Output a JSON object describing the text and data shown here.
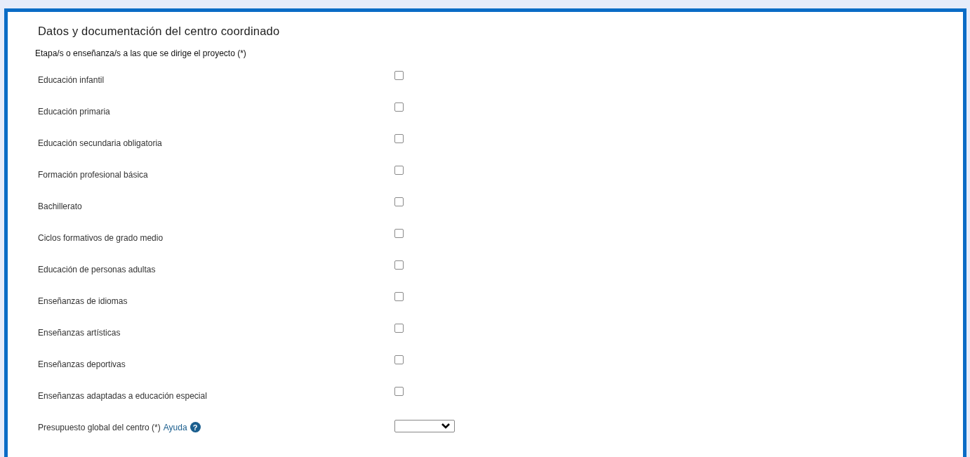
{
  "section": {
    "title": "Datos y documentación del centro coordinado",
    "question": "Etapa/s o enseñanza/s a las que se dirige el proyecto (*)"
  },
  "options": [
    {
      "label": "Educación infantil",
      "checked": false
    },
    {
      "label": "Educación primaria",
      "checked": false
    },
    {
      "label": "Educación secundaria obligatoria",
      "checked": false
    },
    {
      "label": "Formación profesional básica",
      "checked": false
    },
    {
      "label": "Bachillerato",
      "checked": false
    },
    {
      "label": "Ciclos formativos de grado medio",
      "checked": false
    },
    {
      "label": "Educación de personas adultas",
      "checked": false
    },
    {
      "label": "Enseñanzas de idiomas",
      "checked": false
    },
    {
      "label": "Enseñanzas artísticas",
      "checked": false
    },
    {
      "label": "Enseñanzas deportivas",
      "checked": false
    },
    {
      "label": "Enseñanzas adaptadas a educación especial",
      "checked": false
    }
  ],
  "budget": {
    "label": "Presupuesto global del centro (*)",
    "help_link": "Ayuda",
    "help_icon": "?"
  }
}
